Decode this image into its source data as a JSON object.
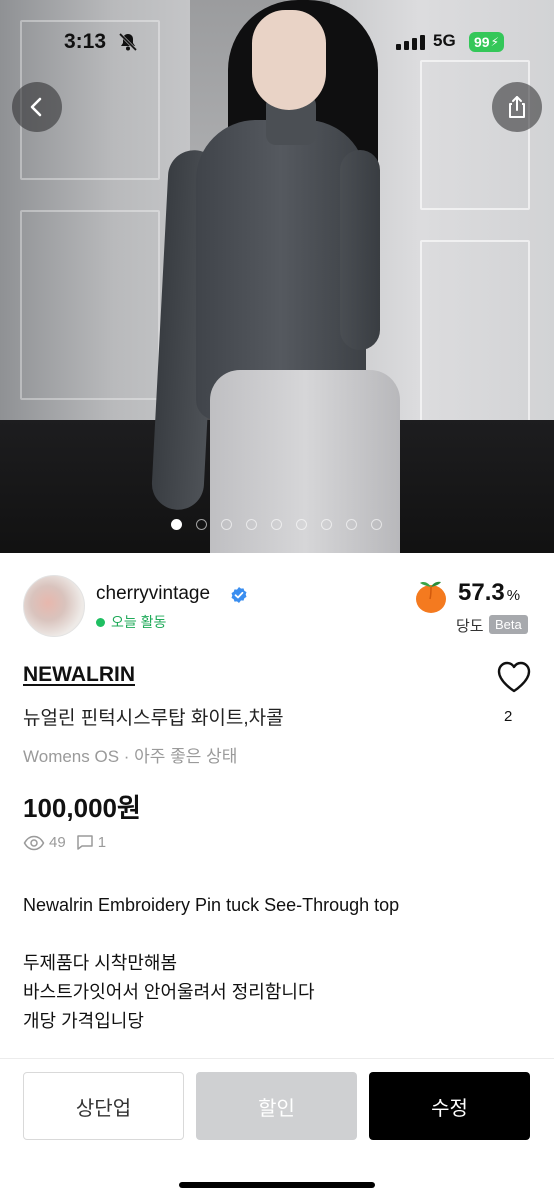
{
  "status_bar": {
    "time": "3:13",
    "network": "5G",
    "battery": "99",
    "bolt": "⚡"
  },
  "hero": {
    "image_count": 9,
    "active_index": 0
  },
  "seller": {
    "name": "cherryvintage",
    "activity": "오늘 활동",
    "sweetness_value": "57.3",
    "sweetness_unit": "%",
    "sweetness_label": "당도",
    "beta": "Beta"
  },
  "product": {
    "brand": "NEWALRIN",
    "title": "뉴얼린 핀턱시스루탑 화이트,차콜",
    "subtitle": "Womens OS · 아주 좋은 상태",
    "price": "100,000원",
    "views": "49",
    "comments": "1",
    "likes": "2"
  },
  "description": {
    "line1": "Newalrin Embroidery Pin tuck See-Through top",
    "line2": "",
    "line3": "두제품다 시착만해봄",
    "line4": "바스트가잇어서 안어울려서 정리함니다",
    "line5": "개당 가격입니당"
  },
  "actions": {
    "bump": "상단업",
    "discount": "할인",
    "edit": "수정"
  },
  "colors": {
    "accent_green": "#1fbf62",
    "verified_blue": "#3a8ef0",
    "peach": "#f47a1f"
  }
}
